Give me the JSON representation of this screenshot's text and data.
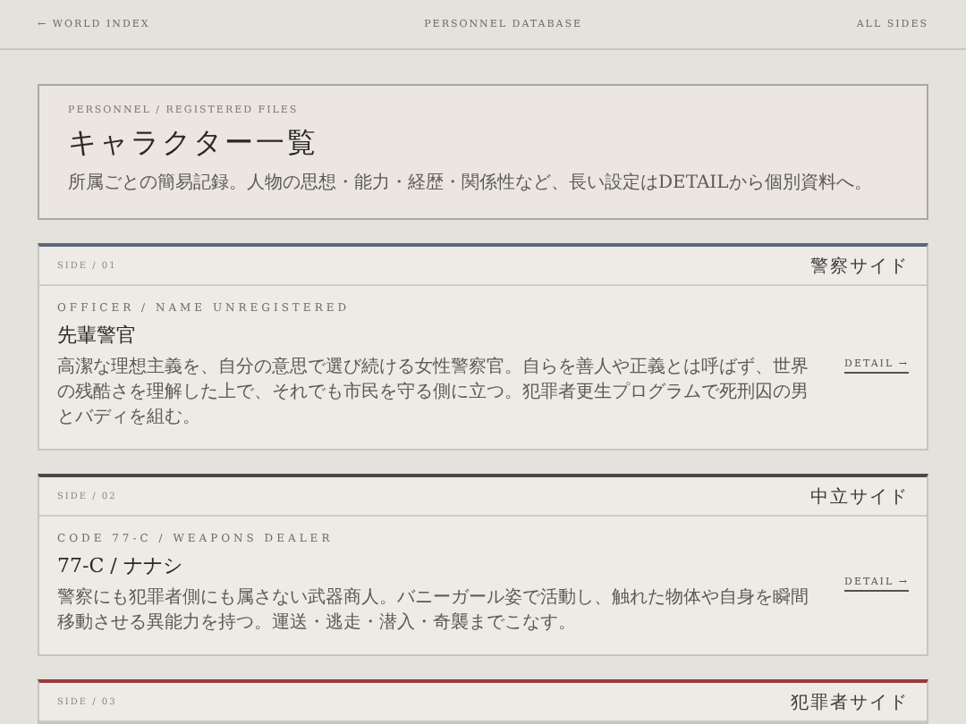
{
  "nav": {
    "back": "← WORLD INDEX",
    "title": "PERSONNEL DATABASE",
    "filter": "ALL SIDES"
  },
  "header": {
    "eyebrow": "PERSONNEL / REGISTERED FILES",
    "title": "キャラクター一覧",
    "description": "所属ごとの簡易記録。人物の思想・能力・経歴・関係性など、長い設定はDETAILから個別資料へ。"
  },
  "sides": [
    {
      "index": "SIDE / 01",
      "name": "警察サイド",
      "color": "#5c6878",
      "characters": [
        {
          "code": "OFFICER / NAME UNREGISTERED",
          "name": "先輩警官",
          "description": "高潔な理想主義を、自分の意思で選び続ける女性警察官。自らを善人や正義とは呼ばず、世界の残酷さを理解した上で、それでも市民を守る側に立つ。犯罪者更生プログラムで死刑囚の男とバディを組む。",
          "link": "DETAIL →"
        }
      ]
    },
    {
      "index": "SIDE / 02",
      "name": "中立サイド",
      "color": "#4a4847",
      "characters": [
        {
          "code": "CODE 77-C / WEAPONS DEALER",
          "name": "77-C / ナナシ",
          "description": "警察にも犯罪者側にも属さない武器商人。バニーガール姿で活動し、触れた物体や自身を瞬間移動させる異能力を持つ。運送・逃走・潜入・奇襲までこなす。",
          "link": "DETAIL →"
        }
      ]
    },
    {
      "index": "SIDE / 03",
      "name": "犯罪者サイド",
      "color": "#9a3a3c"
    }
  ]
}
